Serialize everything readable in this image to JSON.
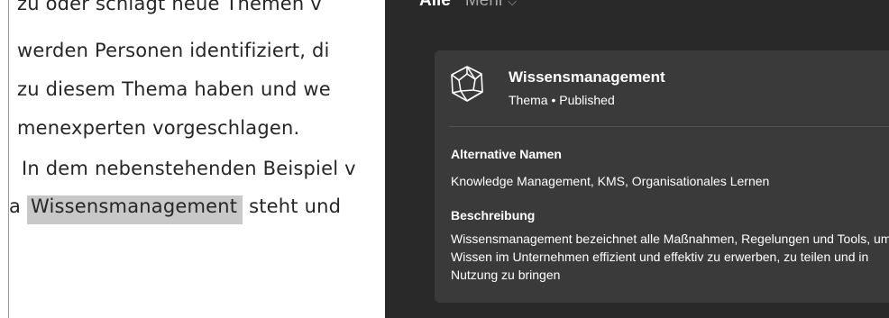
{
  "document": {
    "lines": [
      "zu oder schlägt neue Themen v",
      "werden Personen identifiziert, di",
      "zu diesem Thema haben und we",
      "menexperten vorgeschlagen.",
      "In dem nebenstehenden Beispiel v"
    ],
    "line6_prefix": "a ",
    "highlight": "Wissensmanagement",
    "line6_suffix": " steht und"
  },
  "panel": {
    "tab_active": "Alle",
    "tab_more": "Mehr",
    "card": {
      "icon": "hexagon-knowledge-icon",
      "title": "Wissensmanagement",
      "subtitle": "Thema • Published",
      "alt_names_heading": "Alternative Namen",
      "alt_names": "Knowledge Management, KMS, Organisationales Lernen",
      "desc_heading": "Beschreibung",
      "description": "Wissensmanagement bezeichnet alle Maßnahmen, Regelungen und Tools, um Wissen im Unternehmen effizient und effektiv zu erwerben, zu teilen und in Nutzung zu bringen"
    }
  },
  "colors": {
    "panel_bg": "#292929",
    "card_bg": "#3a3a3a",
    "highlight_bg": "#c8c8c8"
  }
}
